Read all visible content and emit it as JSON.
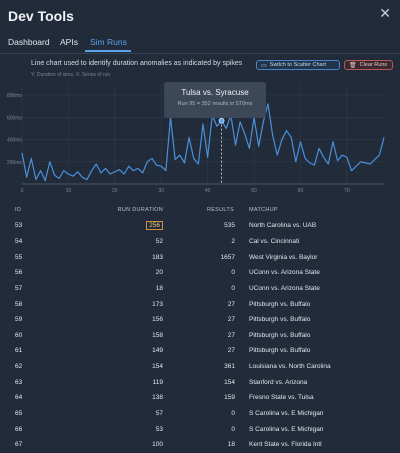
{
  "window": {
    "title": "Dev Tools"
  },
  "tabs": [
    {
      "label": "Dashboard",
      "active": false
    },
    {
      "label": "APIs",
      "active": false
    },
    {
      "label": "Sim Runs",
      "active": true
    }
  ],
  "header": {
    "description": "Line chart used to identify duration anomalies as indicated by spikes",
    "subdescription": "Y: Duration of sims, X: Series of run",
    "scatter_button": "Switch to Scatter Chart",
    "clear_button": "Clear Runs"
  },
  "colors": {
    "accent": "#5aa3e8",
    "line": "#4a90d9",
    "danger": "#b45b5b",
    "highlight": "#d2903c"
  },
  "tooltip": {
    "title": "Tulsa vs. Syracuse",
    "detail": "Run 95 = 352 results in 570ms"
  },
  "chart_data": {
    "type": "line",
    "x_ticks": [
      0,
      10,
      20,
      30,
      40,
      50,
      60,
      70
    ],
    "y_ticks": [
      "200ms",
      "400ms",
      "600ms",
      "800ms"
    ],
    "xlim": [
      0,
      78
    ],
    "ylim": [
      0,
      900
    ],
    "highlight_index": 43,
    "highlight_value": 570,
    "values": [
      280,
      60,
      230,
      40,
      120,
      30,
      200,
      80,
      50,
      120,
      90,
      70,
      110,
      60,
      40,
      120,
      180,
      100,
      140,
      90,
      110,
      130,
      90,
      160,
      120,
      140,
      100,
      200,
      230,
      170,
      160,
      120,
      600,
      220,
      260,
      190,
      420,
      230,
      180,
      540,
      240,
      620,
      520,
      570,
      500,
      620,
      350,
      560,
      450,
      320,
      600,
      340,
      560,
      720,
      440,
      260,
      400,
      480,
      420,
      200,
      380,
      230,
      190,
      170,
      320,
      240,
      180,
      380,
      210,
      260,
      240,
      120,
      160,
      200,
      190,
      180,
      220,
      260,
      420
    ],
    "grid": true
  },
  "table": {
    "headers": {
      "id": "ID",
      "duration": "RUN DURATION",
      "results": "RESULTS",
      "matchup": "MATCHUP"
    },
    "rows": [
      {
        "id": "53",
        "duration": "256",
        "results": "535",
        "matchup": "North Carolina vs. UAB",
        "highlight": true
      },
      {
        "id": "54",
        "duration": "52",
        "results": "2",
        "matchup": "Cal vs. Cincinnati"
      },
      {
        "id": "55",
        "duration": "183",
        "results": "1657",
        "matchup": "West Virginia vs. Baylor"
      },
      {
        "id": "56",
        "duration": "20",
        "results": "0",
        "matchup": "UConn vs. Arizona State"
      },
      {
        "id": "57",
        "duration": "18",
        "results": "0",
        "matchup": "UConn vs. Arizona State"
      },
      {
        "id": "58",
        "duration": "173",
        "results": "27",
        "matchup": "Pittsburgh vs. Buffalo"
      },
      {
        "id": "59",
        "duration": "156",
        "results": "27",
        "matchup": "Pittsburgh vs. Buffalo"
      },
      {
        "id": "60",
        "duration": "158",
        "results": "27",
        "matchup": "Pittsburgh vs. Buffalo"
      },
      {
        "id": "61",
        "duration": "149",
        "results": "27",
        "matchup": "Pittsburgh vs. Buffalo"
      },
      {
        "id": "62",
        "duration": "154",
        "results": "361",
        "matchup": "Louisiana vs. North Carolina"
      },
      {
        "id": "63",
        "duration": "119",
        "results": "154",
        "matchup": "Stanford vs. Arizona"
      },
      {
        "id": "64",
        "duration": "138",
        "results": "159",
        "matchup": "Fresno State vs. Tulsa"
      },
      {
        "id": "65",
        "duration": "57",
        "results": "0",
        "matchup": "S Carolina vs. E Michigan"
      },
      {
        "id": "66",
        "duration": "53",
        "results": "0",
        "matchup": "S Carolina vs. E Michigan"
      },
      {
        "id": "67",
        "duration": "100",
        "results": "18",
        "matchup": "Kent State vs. Florida Intl"
      }
    ]
  }
}
